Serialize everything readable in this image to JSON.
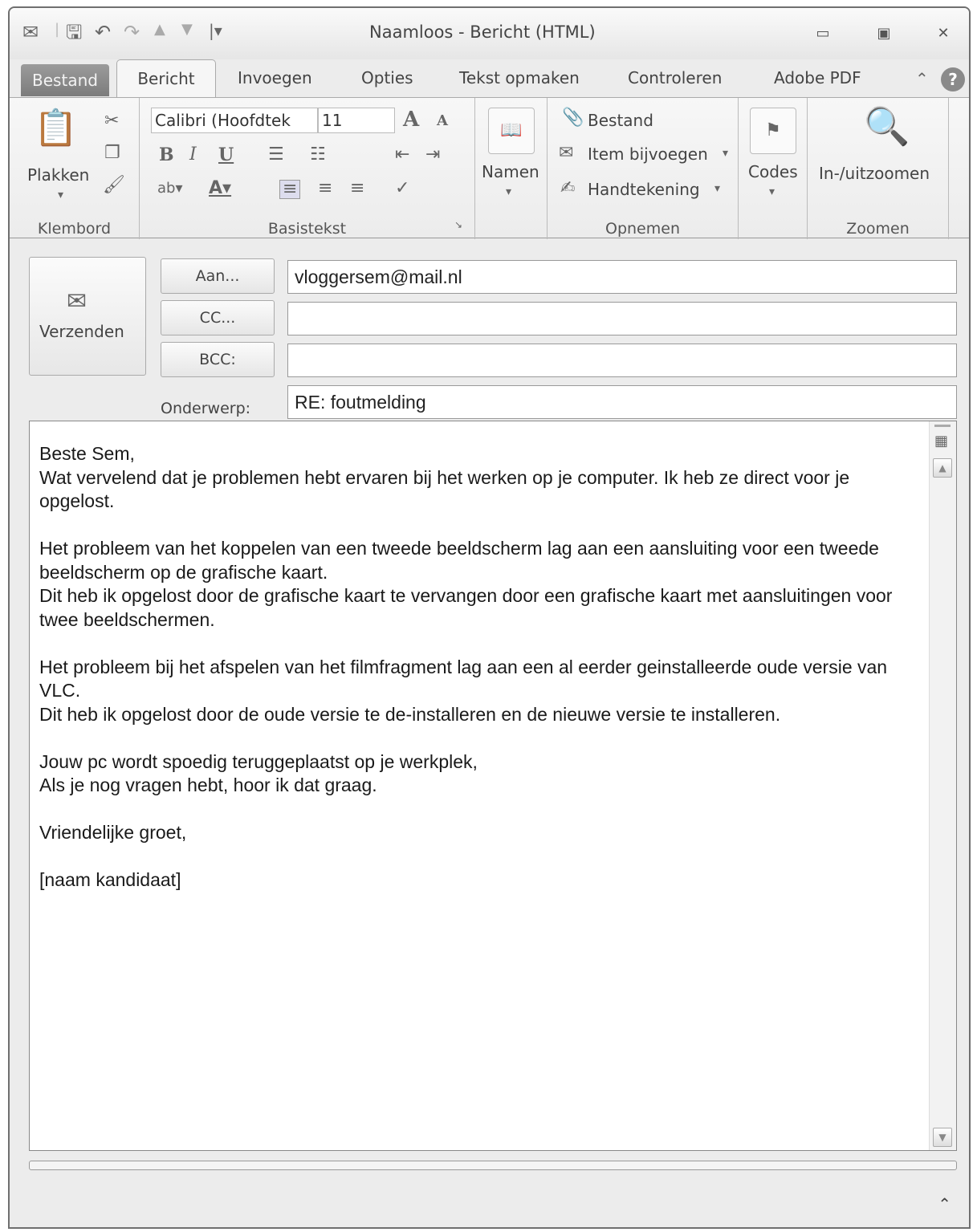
{
  "window": {
    "title": "Naamloos - Bericht (HTML)"
  },
  "tabs": {
    "file": "Bestand",
    "message": "Bericht",
    "insert": "Invoegen",
    "options": "Opties",
    "format_text": "Tekst opmaken",
    "review": "Controleren",
    "adobe": "Adobe PDF"
  },
  "ribbon": {
    "clipboard": {
      "label": "Klembord",
      "paste": "Plakken"
    },
    "basic_text": {
      "label": "Basistekst",
      "font": "Calibri (Hoofdtek",
      "size": "11"
    },
    "names": {
      "label": "Namen"
    },
    "include": {
      "label": "Opnemen",
      "attach_file": "Bestand",
      "attach_item": "Item bijvoegen",
      "signature": "Handtekening"
    },
    "tags": {
      "label": "Codes"
    },
    "zoom": {
      "label": "Zoomen",
      "zoom_btn": "In-/uitzoomen"
    }
  },
  "header": {
    "send": "Verzenden",
    "to_btn": "Aan...",
    "cc_btn": "CC...",
    "bcc_btn": "BCC:",
    "subject_label": "Onderwerp:",
    "to_value": "vloggersem@mail.nl",
    "cc_value": "",
    "bcc_value": "",
    "subject_value": "RE: foutmelding"
  },
  "body": {
    "lines": [
      "Beste Sem,",
      "Wat vervelend dat je problemen hebt ervaren bij het werken op je computer. Ik heb ze direct voor je opgelost.",
      "",
      "Het probleem van het koppelen van een tweede beeldscherm lag aan een aansluiting voor een tweede beeldscherm op de grafische kaart.",
      "Dit heb ik opgelost door de grafische kaart te vervangen door een grafische kaart met aansluitingen voor twee beeldschermen.",
      "",
      "Het probleem bij het afspelen van het filmfragment lag aan een al eerder geinstalleerde oude versie van VLC.",
      "Dit heb ik opgelost door de oude versie te de-installeren en de nieuwe versie te installeren.",
      "",
      "Jouw pc wordt spoedig teruggeplaatst op je werkplek,",
      "Als je nog vragen hebt, hoor ik dat graag.",
      "",
      "Vriendelijke groet,",
      "",
      "[naam kandidaat]"
    ]
  }
}
